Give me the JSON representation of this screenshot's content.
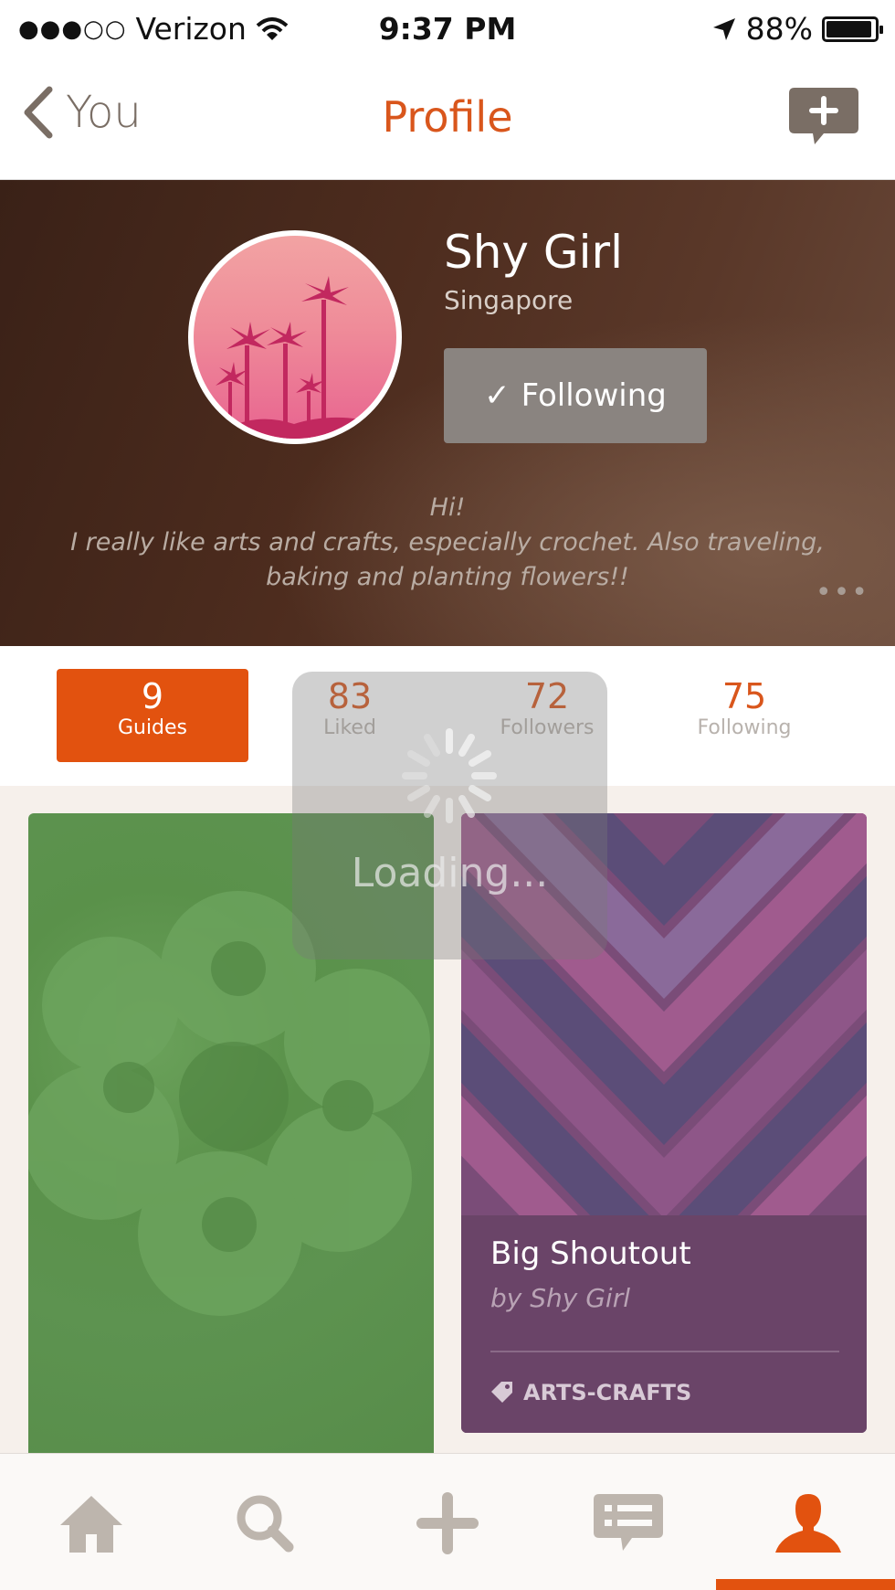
{
  "status_bar": {
    "signal_dots": "●●●○○",
    "carrier": "Verizon",
    "time": "9:37 PM",
    "battery": "88%",
    "battery_level": 0.88,
    "icons": [
      "wifi-icon",
      "location-arrow-icon",
      "battery-icon"
    ]
  },
  "nav": {
    "back_label": "You",
    "title": "Profile",
    "compose_icon": "compose-message-icon"
  },
  "profile": {
    "name": "Shy Girl",
    "location": "Singapore",
    "follow_check": "✓",
    "follow_label": "Following",
    "bio_line1": "Hi!",
    "bio_line2": "I really like arts and crafts, especially crochet. Also traveling,",
    "bio_line3": "baking and planting flowers!!",
    "more_icon": "•••"
  },
  "stats": [
    {
      "value": "9",
      "label": "Guides",
      "active": true
    },
    {
      "value": "83",
      "label": "Liked",
      "active": false
    },
    {
      "value": "72",
      "label": "Followers",
      "active": false
    },
    {
      "value": "75",
      "label": "Following",
      "active": false
    }
  ],
  "cards": [
    {
      "image": "green crochet flower"
    },
    {
      "title": "Big Shoutout",
      "author": "by Shy Girl",
      "tag": "ARTS-CRAFTS",
      "tag_icon": "tag-icon"
    }
  ],
  "loading": {
    "text": "Loading..."
  },
  "tabbar": {
    "items": [
      "home-icon",
      "search-icon",
      "add-icon",
      "messages-icon",
      "profile-icon"
    ],
    "active": "profile-icon",
    "colors": {
      "active": "#e2520f",
      "inactive": "#bdb5ad"
    }
  },
  "colors": {
    "accent": "#d9561c",
    "active_tab_bg": "#e2520f"
  }
}
